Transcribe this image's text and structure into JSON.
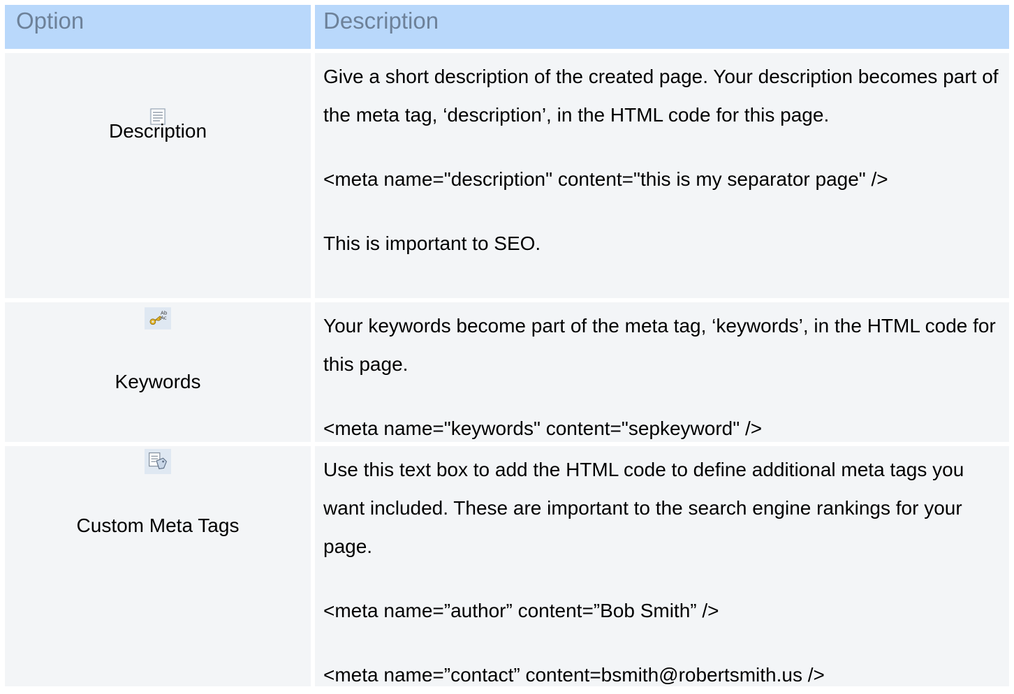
{
  "table": {
    "header": {
      "option": "Option",
      "description": "Description"
    },
    "rows": [
      {
        "icon": "description-page-icon",
        "option": "Description",
        "text": "Give a short description of the created page.  Your description becomes part of the meta tag, ‘description’, in the HTML code for this page.",
        "code": "<meta name=\"description\" content=\"this is my separator page\" />",
        "note": "This is important to SEO."
      },
      {
        "icon": "keywords-key-icon",
        "option": "Keywords",
        "text": "Your keywords become part of the meta tag, ‘keywords’, in the HTML code for this page.",
        "code": "<meta name=\"keywords\" content=\"sepkeyword\" />"
      },
      {
        "icon": "custom-meta-tags-icon",
        "option": "Custom Meta Tags",
        "text": "Use this text box to add the HTML code to define additional meta tags you want included.  These are important to the search engine rankings for your page.",
        "code_1": "<meta name=”author” content=”Bob Smith” />",
        "code_2": "<meta name=”contact” content=bsmith@robertsmith.us />"
      }
    ]
  },
  "colors": {
    "header_bg": "#b9d8fb",
    "header_text": "#6d8199",
    "row_bg": "#f3f5f7"
  }
}
